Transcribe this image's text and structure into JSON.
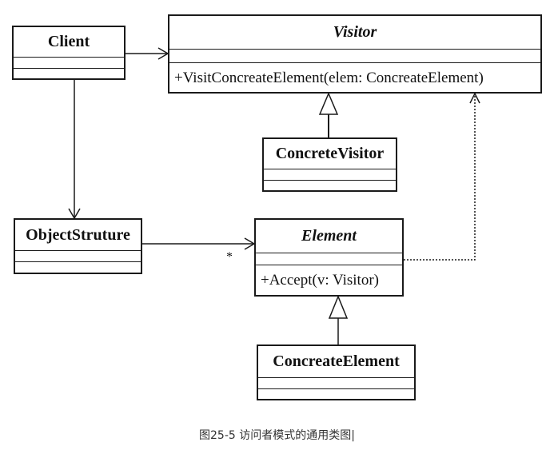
{
  "classes": {
    "client": {
      "name": "Client"
    },
    "visitor": {
      "name": "Visitor",
      "operation": "+VisitConcreateElement(elem: ConcreateElement)"
    },
    "concrete_visitor": {
      "name": "ConcreteVisitor"
    },
    "object_structure": {
      "name": "ObjectStruture"
    },
    "element": {
      "name": "Element",
      "operation": "+Accept(v: Visitor)"
    },
    "concreate_element": {
      "name": "ConcreateElement"
    }
  },
  "relations": {
    "object_structure_to_element_multiplicity": "*"
  },
  "caption": "图25-5 访问者模式的通用类图|"
}
